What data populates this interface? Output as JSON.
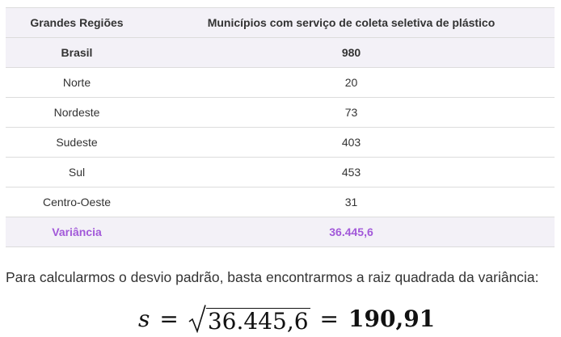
{
  "table": {
    "headers": [
      "Grandes Regiões",
      "Municípios com serviço de coleta seletiva de plástico"
    ],
    "brasil": {
      "region": "Brasil",
      "value": "980"
    },
    "rows": [
      {
        "region": "Norte",
        "value": "20"
      },
      {
        "region": "Nordeste",
        "value": "73"
      },
      {
        "region": "Sudeste",
        "value": "403"
      },
      {
        "region": "Sul",
        "value": "453"
      },
      {
        "region": "Centro-Oeste",
        "value": "31"
      }
    ],
    "variance": {
      "label": "Variância",
      "value": "36.445,6"
    }
  },
  "text": {
    "paragraph": "Para calcularmos o desvio padrão, basta encontrarmos a raiz quadrada da variância:"
  },
  "formula": {
    "variable": "s",
    "equals": "=",
    "radicand": "36.445,6",
    "result": "190,91"
  },
  "colors": {
    "header_bg": "#f3f1f7",
    "variance_text": "#a259d9",
    "border": "#dcdcdc"
  }
}
